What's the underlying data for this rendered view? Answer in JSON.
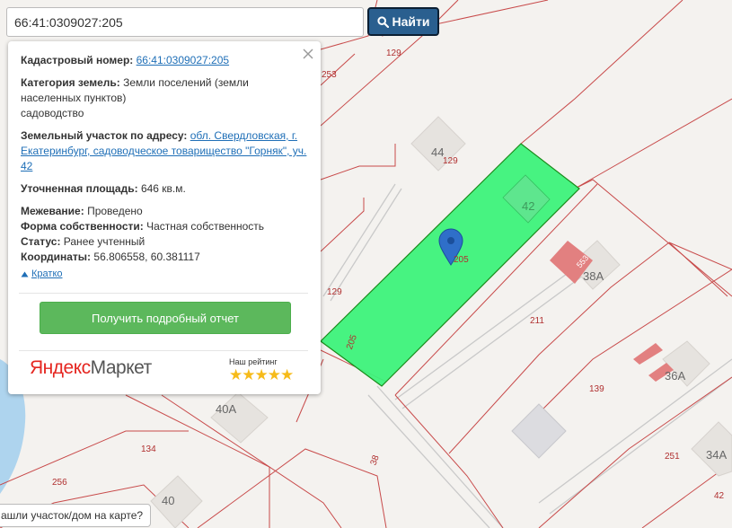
{
  "search": {
    "value": "66:41:0309027:205",
    "button_label": "Найти"
  },
  "popup": {
    "cadastral_label": "Кадастровый номер:",
    "cadastral_value": "66:41:0309027:205",
    "category_label": "Категория земель:",
    "category_value": "Земли поселений (земли населенных пунктов)",
    "category_sub": "садоводство",
    "address_label": "Земельный участок по адресу:",
    "address_value": "обл. Свердловская, г. Екатеринбург, садоводческое товарищество \"Горняк\", уч. 42",
    "area_label": "Уточненная площадь:",
    "area_value": "646 кв.м.",
    "survey_label": "Межевание:",
    "survey_value": "Проведено",
    "ownership_label": "Форма собственности:",
    "ownership_value": "Частная собственность",
    "status_label": "Статус:",
    "status_value": "Ранее учтенный",
    "coords_label": "Координаты:",
    "coords_value": "56.806558, 60.381117",
    "brief_label": "Кратко",
    "report_button": "Получить подробный отчет",
    "market_logo_a": "Яндекс",
    "market_logo_b": "Маркет",
    "rating_label": "Наш рейтинг",
    "rating_stars": "★★★★★"
  },
  "map": {
    "labels": {
      "n129_top": "129",
      "n253": "253",
      "n44": "44",
      "n129_mid": "129",
      "n42_mid": "42",
      "n205_pin": "205",
      "n553": "553",
      "n38a": "38А",
      "n129_left": "129",
      "n211": "211",
      "n205_side": "205",
      "n36a": "36А",
      "n139": "139",
      "n40a": "40А",
      "n134": "134",
      "n38": "38",
      "n256": "256",
      "n40": "40",
      "n251": "251",
      "n34a": "34А",
      "n42_br": "42"
    },
    "colors": {
      "parcel_fill": "#3df27a",
      "parcel_border": "#1a8a1a",
      "boundary": "#c84a4a",
      "water": "#aed4ee",
      "building": "#e6e3df",
      "building_red": "#e28080",
      "label": "#b03030"
    }
  },
  "bottom_tip": {
    "text": "ашли участок/дом на карте?"
  }
}
